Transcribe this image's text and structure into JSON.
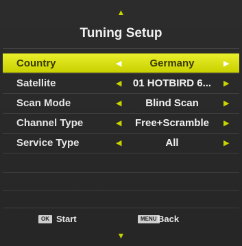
{
  "header": {
    "title": "Tuning Setup",
    "up_arrow": "▲",
    "down_arrow": "▼"
  },
  "menu": {
    "items": [
      {
        "label": "Country",
        "value": "Germany",
        "selected": true
      },
      {
        "label": "Satellite",
        "value": "01 HOTBIRD 6...",
        "selected": false
      },
      {
        "label": "Scan Mode",
        "value": "Blind Scan",
        "selected": false
      },
      {
        "label": "Channel Type",
        "value": "Free+Scramble",
        "selected": false
      },
      {
        "label": "Service Type",
        "value": "All",
        "selected": false
      }
    ],
    "left_arrow": "◀",
    "right_arrow": "▶"
  },
  "footer": {
    "ok_key": "OK",
    "ok_label": "Start",
    "menu_key": "MENU",
    "menu_label": "Back"
  },
  "colors": {
    "accent": "#c8d400",
    "selected_bg": "#dfe61c",
    "panel_bg": "#2b2b2b"
  }
}
